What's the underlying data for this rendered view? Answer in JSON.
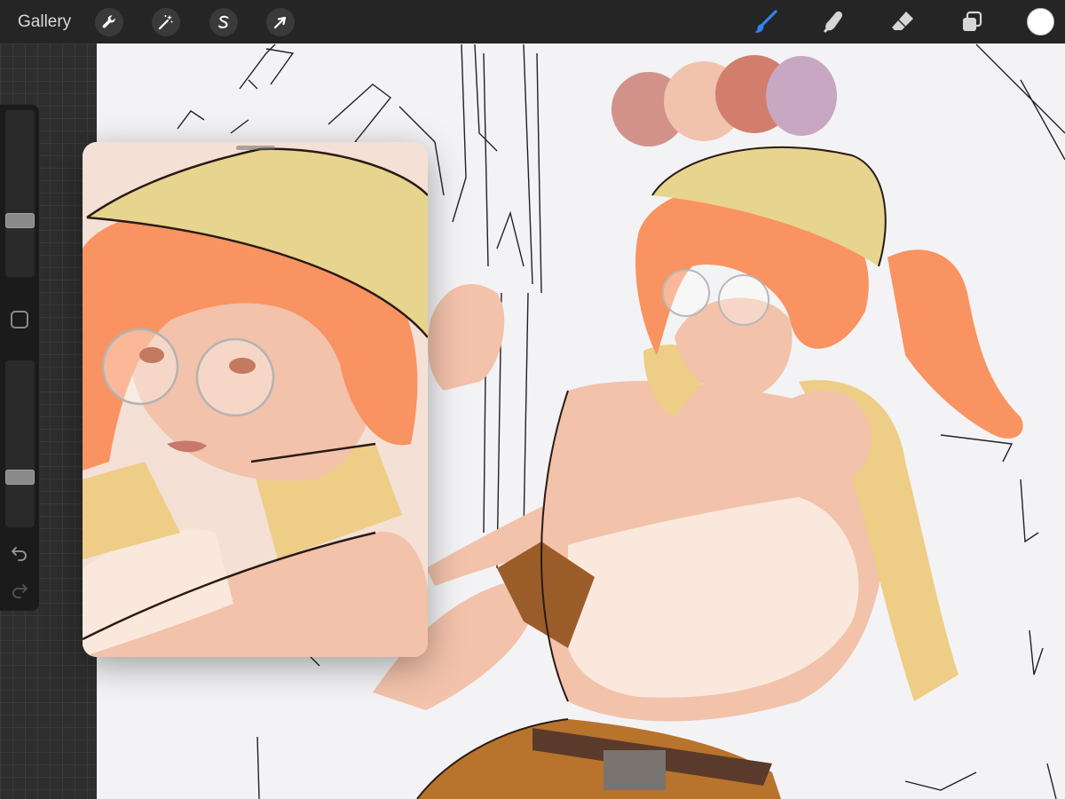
{
  "toolbar": {
    "gallery_label": "Gallery",
    "left_tools": [
      {
        "name": "actions",
        "icon": "wrench-icon"
      },
      {
        "name": "adjustments",
        "icon": "magic-wand-icon"
      },
      {
        "name": "selection",
        "icon": "selection-s-icon"
      },
      {
        "name": "transform",
        "icon": "arrow-cursor-icon"
      }
    ],
    "right_tools": [
      {
        "name": "brush",
        "icon": "brush-icon",
        "active": true
      },
      {
        "name": "smudge",
        "icon": "smudge-finger-icon",
        "active": false
      },
      {
        "name": "eraser",
        "icon": "eraser-icon",
        "active": false
      },
      {
        "name": "layers",
        "icon": "layers-icon",
        "active": false
      }
    ],
    "current_color": "#ffffff",
    "active_color": "#2f84f0"
  },
  "sidebar": {
    "brush_size_level": 0.32,
    "opacity_level": 0.28,
    "modify_icon": "square-modify-icon",
    "undo_icon": "undo-icon",
    "redo_icon": "redo-icon"
  },
  "palette": [
    "#d2928a",
    "#f1c3ad",
    "#d27e6c",
    "#c7a7c2"
  ],
  "art_colors": {
    "hair": "#f99362",
    "hat": "#e7d48e",
    "skin": "#f2c2aa",
    "skin_shadow": "#e3a08e",
    "jacket": "#eecd86",
    "top": "#fae8dd",
    "wristband": "#9a5d2a",
    "shorts": "#b8732c",
    "belt": "#5a3a2a",
    "buckle": "#7a7470",
    "lineart": "#2a1a16"
  }
}
